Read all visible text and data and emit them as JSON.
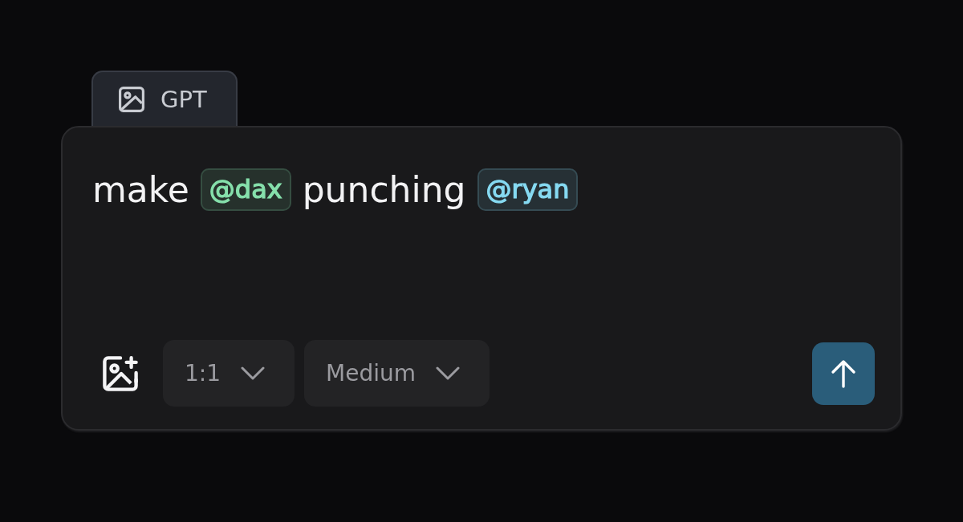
{
  "model_tab": {
    "label": "GPT"
  },
  "prompt": {
    "segments": [
      {
        "kind": "text",
        "text": "make"
      },
      {
        "kind": "mention",
        "text": "@dax",
        "color": "#86e0ac"
      },
      {
        "kind": "text",
        "text": "punching"
      },
      {
        "kind": "mention",
        "text": "@ryan",
        "color": "#86daf2"
      }
    ]
  },
  "toolbar": {
    "dropdowns": [
      {
        "value": "1:1"
      },
      {
        "value": "Medium"
      }
    ]
  }
}
